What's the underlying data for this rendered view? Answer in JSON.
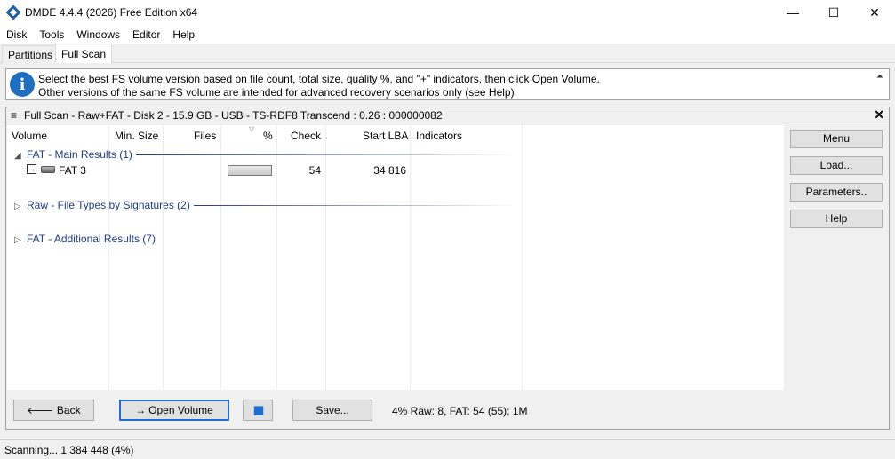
{
  "window": {
    "title": "DMDE 4.4.4 (2026) Free Edition x64",
    "minimize_glyph": "—",
    "maximize_glyph": "☐",
    "close_glyph": "✕"
  },
  "menu": [
    "Disk",
    "Tools",
    "Windows",
    "Editor",
    "Help"
  ],
  "tabs": [
    {
      "label": "Partitions",
      "active": false
    },
    {
      "label": "Full Scan",
      "active": true
    }
  ],
  "info": {
    "icon": "info-icon",
    "icon_glyph": "i",
    "line1": "Select the best FS volume version based on file count, total size, quality %, and \"+\" indicators, then click Open Volume.",
    "line2": "Other versions of the same FS volume are intended for advanced recovery scenarios only (see Help)",
    "collapse_glyph": "⏶"
  },
  "scan": {
    "title": "Full Scan - Raw+FAT - Disk 2 - 15.9 GB - USB - TS-RDF8  Transcend    : 0.26 : 000000082",
    "menu_glyph": "≡",
    "close_glyph": "✕",
    "columns": [
      "Volume",
      "Min. Size",
      "Files",
      "%",
      "Check",
      "Start LBA",
      "Indicators"
    ],
    "sort_glyph": "▽",
    "groups": [
      {
        "label": "FAT - Main Results (1)",
        "toggle": "◢"
      },
      {
        "label": "Raw - File Types by Signatures (2)",
        "toggle": "▷"
      },
      {
        "label": "FAT - Additional Results (7)",
        "toggle": "▷"
      }
    ],
    "volume_row": {
      "name": "FAT 3",
      "arrow_glyph": "→",
      "min_size": "",
      "files": "",
      "percent_fill": 0,
      "check": "54",
      "start_lba": "34 816",
      "indicators": ""
    }
  },
  "side_buttons": {
    "menu": "Menu",
    "load": "Load...",
    "parameters": "Parameters..",
    "help": "Help"
  },
  "bottom": {
    "back": "Back",
    "back_glyph": "🡐",
    "open_volume": "Open Volume",
    "open_glyph": "→",
    "pause_glyph": "▮▮",
    "save": "Save...",
    "progress": "4% Raw: 8, FAT: 54 (55); 1M"
  },
  "status": {
    "text": "Scanning... 1 384 448 (4%)"
  },
  "colors": {
    "accent": "#1f6fd0",
    "group_text": "#1f3c88",
    "info_icon": "#1e6fc0"
  }
}
